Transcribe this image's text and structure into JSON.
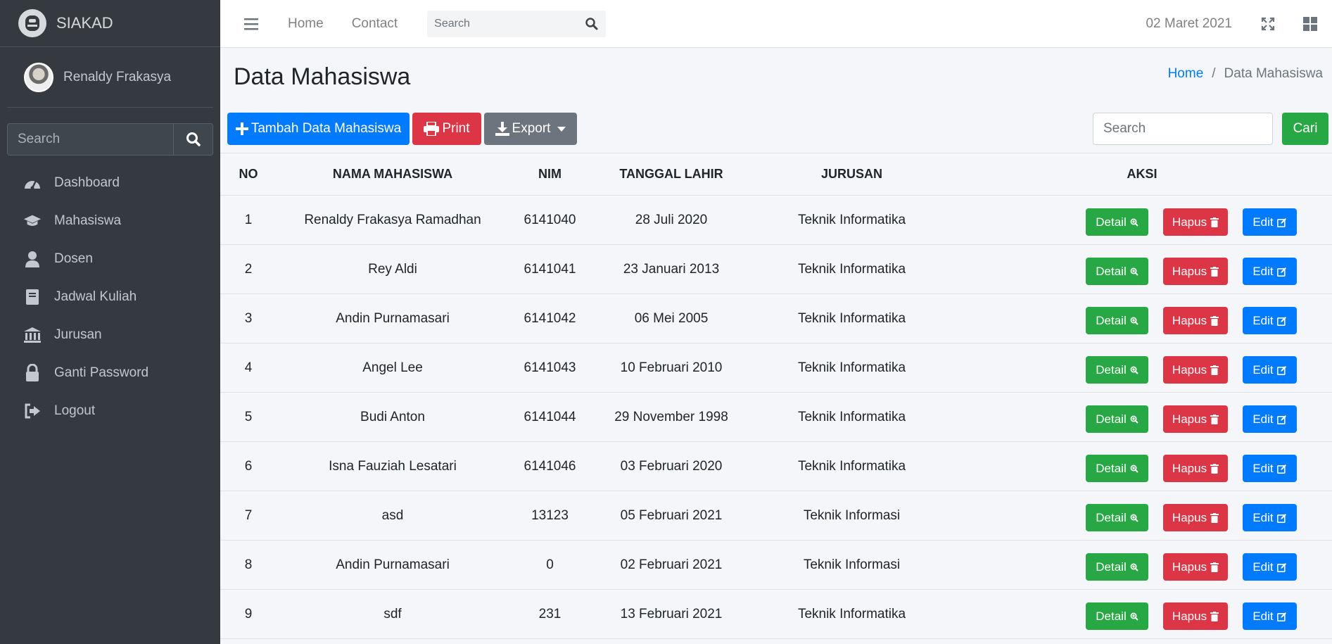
{
  "sidebar": {
    "brand": "SIAKAD",
    "user_name": "Renaldy Frakasya",
    "search_placeholder": "Search",
    "items": [
      {
        "label": "Dashboard",
        "icon": "tachometer-icon"
      },
      {
        "label": "Mahasiswa",
        "icon": "graduation-cap-icon"
      },
      {
        "label": "Dosen",
        "icon": "user-icon"
      },
      {
        "label": "Jadwal Kuliah",
        "icon": "book-icon"
      },
      {
        "label": "Jurusan",
        "icon": "university-icon"
      },
      {
        "label": "Ganti Password",
        "icon": "lock-icon"
      },
      {
        "label": "Logout",
        "icon": "sign-out-icon"
      }
    ]
  },
  "topbar": {
    "links": [
      "Home",
      "Contact"
    ],
    "search_placeholder": "Search",
    "date": "02 Maret 2021"
  },
  "page": {
    "title": "Data Mahasiswa",
    "breadcrumb": [
      "Home",
      "Data Mahasiswa"
    ]
  },
  "toolbar": {
    "add_label": "Tambah Data Mahasiswa",
    "print_label": "Print",
    "export_label": "Export",
    "search_placeholder": "Search",
    "search_button": "Cari"
  },
  "table": {
    "headers": [
      "NO",
      "NAMA MAHASISWA",
      "NIM",
      "TANGGAL LAHIR",
      "JURUSAN",
      "AKSI"
    ],
    "action_labels": {
      "detail": "Detail",
      "hapus": "Hapus",
      "edit": "Edit"
    },
    "rows": [
      {
        "no": "1",
        "nama": "Renaldy Frakasya Ramadhan",
        "nim": "6141040",
        "tgl": "28 Juli 2020",
        "jurusan": "Teknik Informatika"
      },
      {
        "no": "2",
        "nama": "Rey Aldi",
        "nim": "6141041",
        "tgl": "23 Januari 2013",
        "jurusan": "Teknik Informatika"
      },
      {
        "no": "3",
        "nama": "Andin Purnamasari",
        "nim": "6141042",
        "tgl": "06 Mei 2005",
        "jurusan": "Teknik Informatika"
      },
      {
        "no": "4",
        "nama": "Angel Lee",
        "nim": "6141043",
        "tgl": "10 Februari 2010",
        "jurusan": "Teknik Informatika"
      },
      {
        "no": "5",
        "nama": "Budi Anton",
        "nim": "6141044",
        "tgl": "29 November 1998",
        "jurusan": "Teknik Informatika"
      },
      {
        "no": "6",
        "nama": "Isna Fauziah Lesatari",
        "nim": "6141046",
        "tgl": "03 Februari 2020",
        "jurusan": "Teknik Informatika"
      },
      {
        "no": "7",
        "nama": "asd",
        "nim": "13123",
        "tgl": "05 Februari 2021",
        "jurusan": "Teknik Informasi"
      },
      {
        "no": "8",
        "nama": "Andin Purnamasari",
        "nim": "0",
        "tgl": "02 Februari 2021",
        "jurusan": "Teknik Informasi"
      },
      {
        "no": "9",
        "nama": "sdf",
        "nim": "231",
        "tgl": "13 Februari 2021",
        "jurusan": "Teknik Informatika"
      }
    ]
  },
  "colors": {
    "sidebar_bg": "#343a40",
    "primary": "#007bff",
    "danger": "#dc3545",
    "success": "#28a745",
    "secondary": "#6c757d"
  }
}
